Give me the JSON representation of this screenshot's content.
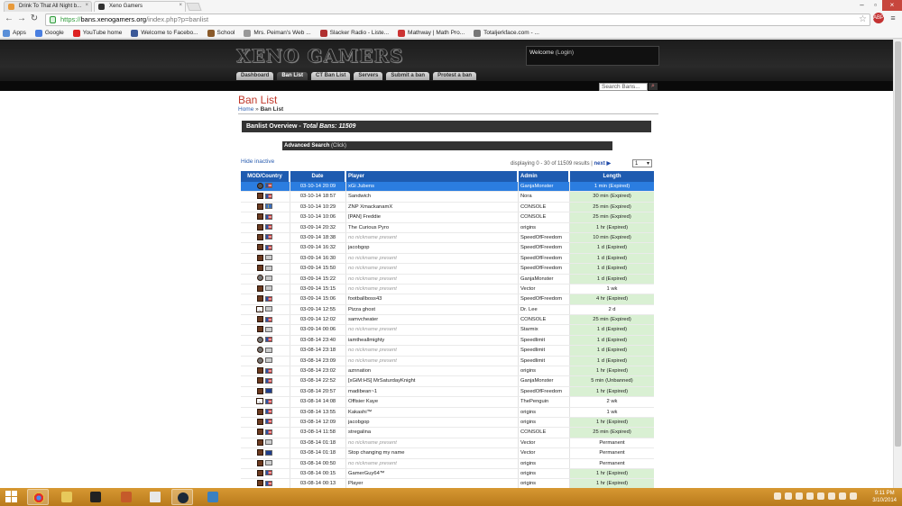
{
  "browser": {
    "tabs": [
      {
        "title": "Drink To That All Night b..."
      },
      {
        "title": "Xeno Gamers"
      }
    ],
    "url": {
      "scheme": "https://",
      "host": "bans.xenogamers.org",
      "path": "/index.php?p=banlist"
    },
    "bookmarks": [
      "Apps",
      "Google",
      "YouTube home",
      "Welcome to Facebo...",
      "School",
      "Mrs. Peiman's Web ...",
      "Slacker Radio - Liste...",
      "Mathway | Math Pro...",
      "Totaljerkface.com - ..."
    ],
    "ext_badge": "ABP"
  },
  "site": {
    "logo": "XENO GAMERS",
    "welcome": "Welcome",
    "login": "(Login)",
    "nav": [
      "Dashboard",
      "Ban List",
      "CT Ban List",
      "Servers",
      "Submit a ban",
      "Protest a ban"
    ],
    "search_placeholder": "Search Bans..."
  },
  "page": {
    "title": "Ban List",
    "breadcrumb": {
      "home": "Home",
      "sep": " » ",
      "current": "Ban List"
    },
    "overview_label": "Banlist Overview - ",
    "overview_total": "Total Bans: 11509",
    "advanced_search": "Advanced Search",
    "advanced_click": "(Click)",
    "hide_inactive": "Hide inactive",
    "displaying": "displaying 0 - 30 of 11509 results | ",
    "next": "next ▶",
    "page_select": "1",
    "columns": [
      "MOD/Country",
      "Date",
      "Player",
      "Admin",
      "Length"
    ],
    "rows": [
      {
        "mod": "tf",
        "flag": "us",
        "date": "03-10-14 20:09",
        "player": "xGi Jubens",
        "nonick": false,
        "admin": "GanjaMonster",
        "length": "1 min (Expired)",
        "exp": true,
        "sel": true
      },
      {
        "mod": "mod",
        "flag": "us",
        "date": "03-10-14 18:57",
        "player": "Sandwich",
        "nonick": false,
        "admin": "Nora",
        "length": "30 min (Expired)",
        "exp": true
      },
      {
        "mod": "mod",
        "flag": "se",
        "date": "03-10-14 10:29",
        "player": "ZNP XmackanamX",
        "nonick": false,
        "admin": "CONSOLE",
        "length": "25 min (Expired)",
        "exp": true
      },
      {
        "mod": "mod",
        "flag": "us",
        "date": "03-10-14 10:06",
        "player": "[PAN] Freddie",
        "nonick": false,
        "admin": "CONSOLE",
        "length": "25 min (Expired)",
        "exp": true
      },
      {
        "mod": "mod",
        "flag": "us",
        "date": "03-09-14 20:32",
        "player": "The Curious Pyro",
        "nonick": false,
        "admin": "origins",
        "length": "1 hr (Expired)",
        "exp": true
      },
      {
        "mod": "mod",
        "flag": "us",
        "date": "03-09-14 18:38",
        "player": "no nickname present",
        "nonick": true,
        "admin": "SpeedOfFreedom",
        "length": "10 min (Expired)",
        "exp": true
      },
      {
        "mod": "mod",
        "flag": "us",
        "date": "03-09-14 16:32",
        "player": "jacobgop",
        "nonick": false,
        "admin": "SpeedOfFreedom",
        "length": "1 d (Expired)",
        "exp": true
      },
      {
        "mod": "mod",
        "flag": "unk",
        "date": "03-09-14 16:30",
        "player": "no nickname present",
        "nonick": true,
        "admin": "SpeedOfFreedom",
        "length": "1 d (Expired)",
        "exp": true
      },
      {
        "mod": "mod",
        "flag": "unk",
        "date": "03-09-14 15:50",
        "player": "no nickname present",
        "nonick": true,
        "admin": "SpeedOfFreedom",
        "length": "1 d (Expired)",
        "exp": true
      },
      {
        "mod": "css",
        "flag": "unk",
        "date": "03-09-14 15:22",
        "player": "no nickname present",
        "nonick": true,
        "admin": "GanjaMonster",
        "length": "1 d (Expired)",
        "exp": true
      },
      {
        "mod": "mod",
        "flag": "unk",
        "date": "03-09-14 15:15",
        "player": "no nickname present",
        "nonick": true,
        "admin": "Vector",
        "length": "1 wk",
        "exp": false
      },
      {
        "mod": "mod",
        "flag": "us",
        "date": "03-09-14 15:06",
        "player": "footballboss43",
        "nonick": false,
        "admin": "SpeedOfFreedom",
        "length": "4 hr (Expired)",
        "exp": true
      },
      {
        "mod": "unk2",
        "flag": "unk",
        "date": "03-09-14 12:55",
        "player": "Pizza ghost",
        "nonick": false,
        "admin": "Dr. Lee",
        "length": "2 d",
        "exp": false
      },
      {
        "mod": "mod",
        "flag": "us",
        "date": "03-09-14 12:02",
        "player": "samvcheater",
        "nonick": false,
        "admin": "CONSOLE",
        "length": "25 min (Expired)",
        "exp": true
      },
      {
        "mod": "mod",
        "flag": "unk",
        "date": "03-09-14 00:06",
        "player": "no nickname present",
        "nonick": true,
        "admin": "Starmix",
        "length": "1 d (Expired)",
        "exp": true
      },
      {
        "mod": "css",
        "flag": "us",
        "date": "03-08-14 23:40",
        "player": "iamtheallmighty",
        "nonick": false,
        "admin": "Speedlimit",
        "length": "1 d (Expired)",
        "exp": true
      },
      {
        "mod": "css",
        "flag": "unk",
        "date": "03-08-14 23:18",
        "player": "no nickname present",
        "nonick": true,
        "admin": "Speedlimit",
        "length": "1 d (Expired)",
        "exp": true
      },
      {
        "mod": "css",
        "flag": "unk",
        "date": "03-08-14 23:09",
        "player": "no nickname present",
        "nonick": true,
        "admin": "Speedlimit",
        "length": "1 d (Expired)",
        "exp": true
      },
      {
        "mod": "mod",
        "flag": "us",
        "date": "03-08-14 23:02",
        "player": "aznnation",
        "nonick": false,
        "admin": "origins",
        "length": "1 hr (Expired)",
        "exp": true
      },
      {
        "mod": "mod",
        "flag": "us",
        "date": "03-08-14 22:52",
        "player": "[xGiM:HS] MrSaturdayKnight",
        "nonick": false,
        "admin": "GanjaMonster",
        "length": "5 min (Unbanned)",
        "exp": true
      },
      {
        "mod": "mod",
        "flag": "au",
        "date": "03-08-14 20:57",
        "player": "madibean~1",
        "nonick": false,
        "admin": "SpeedOfFreedom",
        "length": "1 hr (Expired)",
        "exp": true
      },
      {
        "mod": "unk2",
        "flag": "us",
        "date": "03-08-14 14:08",
        "player": "Offisier Kaye",
        "nonick": false,
        "admin": "ThePenguin",
        "length": "2 wk",
        "exp": false
      },
      {
        "mod": "mod",
        "flag": "us",
        "date": "03-08-14 13:55",
        "player": "Kakashi™",
        "nonick": false,
        "admin": "origins",
        "length": "1 wk",
        "exp": false
      },
      {
        "mod": "mod",
        "flag": "us",
        "date": "03-08-14 12:09",
        "player": "jacobgop",
        "nonick": false,
        "admin": "origins",
        "length": "1 hr (Expired)",
        "exp": true
      },
      {
        "mod": "mod",
        "flag": "us",
        "date": "03-08-14 11:58",
        "player": "stregalina",
        "nonick": false,
        "admin": "CONSOLE",
        "length": "25 min (Expired)",
        "exp": true
      },
      {
        "mod": "mod",
        "flag": "unk",
        "date": "03-08-14 01:18",
        "player": "no nickname present",
        "nonick": true,
        "admin": "Vector",
        "length": "Permanent",
        "exp": false
      },
      {
        "mod": "mod",
        "flag": "au",
        "date": "03-08-14 01:18",
        "player": "Stop changing my name",
        "nonick": false,
        "admin": "Vector",
        "length": "Permanent",
        "exp": false
      },
      {
        "mod": "mod",
        "flag": "unk",
        "date": "03-08-14 00:50",
        "player": "no nickname present",
        "nonick": true,
        "admin": "origins",
        "length": "Permanent",
        "exp": false
      },
      {
        "mod": "mod",
        "flag": "us",
        "date": "03-08-14 00:15",
        "player": "GamerGuy64™",
        "nonick": false,
        "admin": "origins",
        "length": "1 hr (Expired)",
        "exp": true
      },
      {
        "mod": "mod",
        "flag": "us",
        "date": "03-08-14 00:13",
        "player": "Player",
        "nonick": false,
        "admin": "origins",
        "length": "1 hr (Expired)",
        "exp": true
      }
    ]
  },
  "taskbar": {
    "time": "9:11 PM",
    "date": "3/10/2014"
  },
  "colors": {
    "accent": "#1e5bb0",
    "title_red": "#c0392b",
    "expired_bg": "#d9f0d3",
    "taskbar": "#c88a26"
  }
}
